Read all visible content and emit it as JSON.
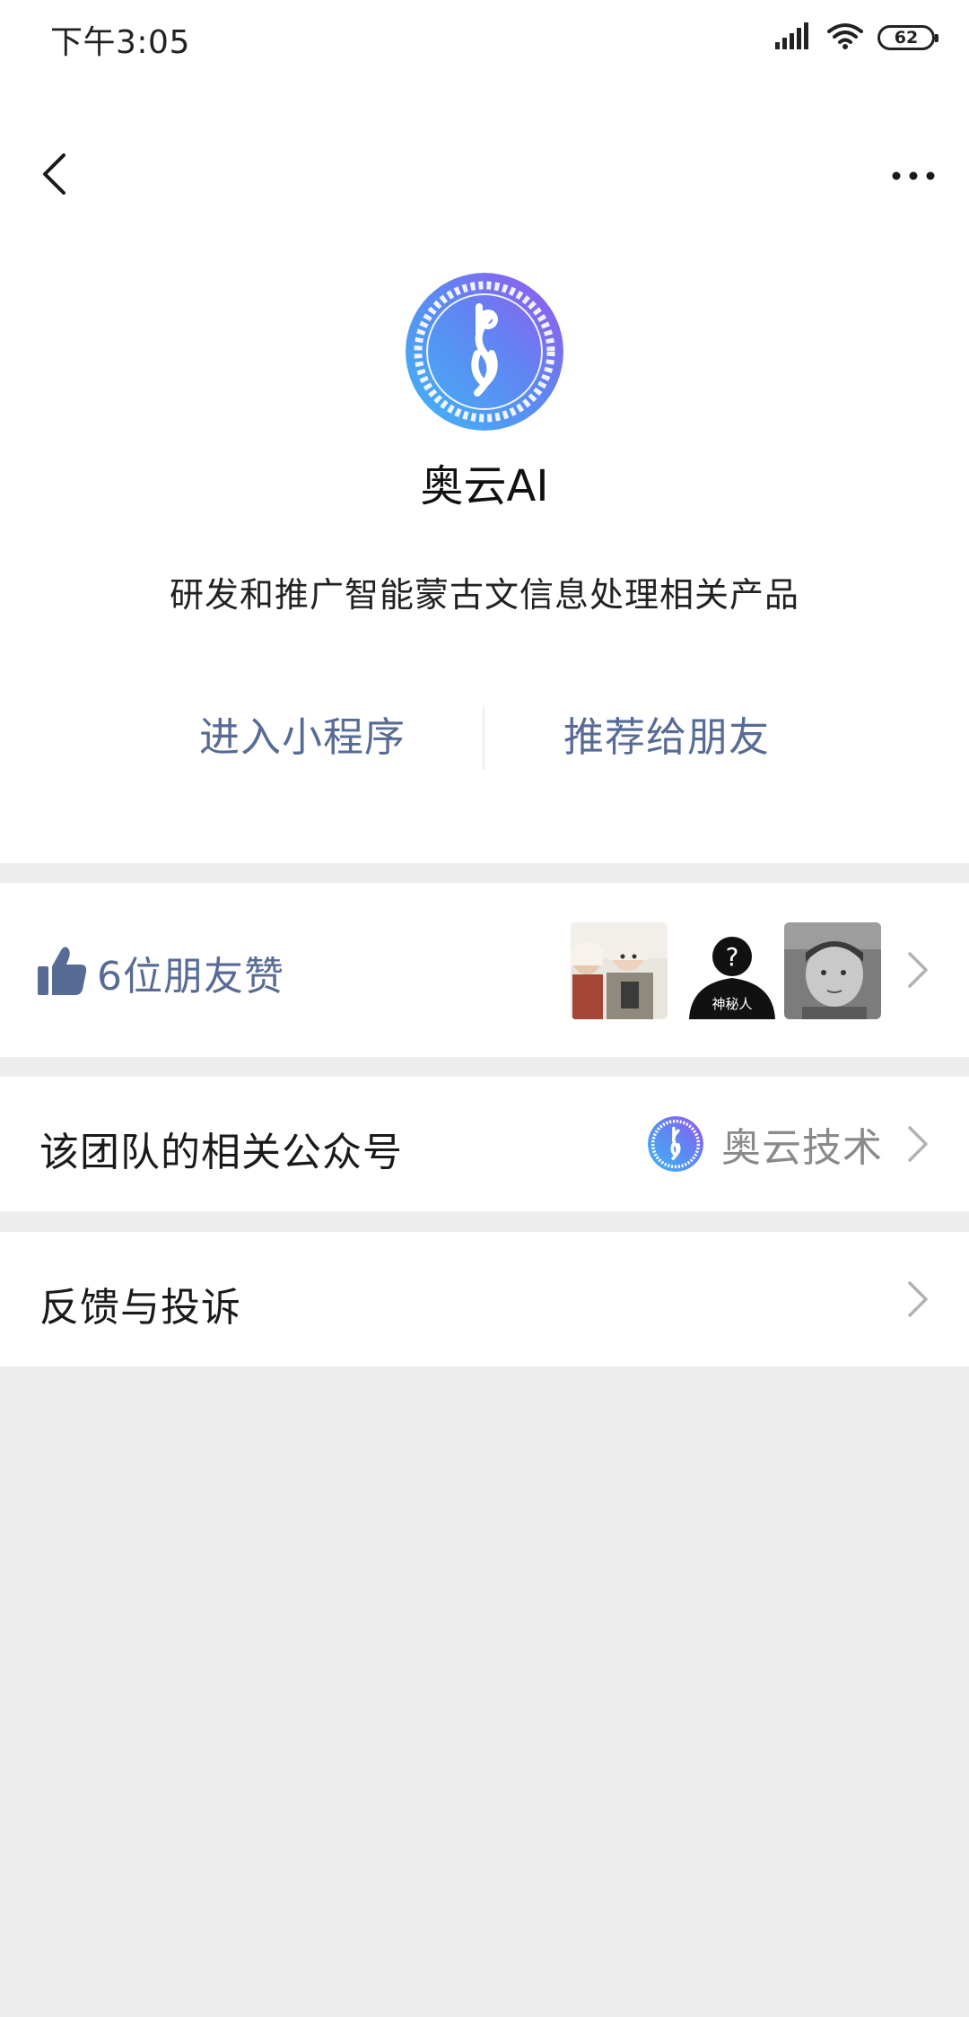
{
  "status_bar": {
    "time": "下午3:05",
    "battery": "62"
  },
  "nav": {
    "back_icon": "chevron-left-icon",
    "more_icon": "more-dots-icon"
  },
  "app": {
    "name": "奥云AI",
    "description": "研发和推广智能蒙古文信息处理相关产品",
    "logo_icon": "aoyun-logo",
    "brand_gradient": [
      "#4ea9f5",
      "#8a5cf0"
    ]
  },
  "actions": {
    "enter_label": "进入小程序",
    "share_label": "推荐给朋友",
    "link_color": "#576b95"
  },
  "likes": {
    "icon": "thumbs-up-icon",
    "text": "6位朋友赞",
    "avatars": [
      {
        "name": "friend-avatar-1",
        "caption": ""
      },
      {
        "name": "friend-avatar-mystery",
        "caption": "神秘人"
      },
      {
        "name": "friend-avatar-3",
        "caption": ""
      }
    ]
  },
  "related": {
    "label": "该团队的相关公众号",
    "account_name": "奥云技术"
  },
  "feedback": {
    "label": "反馈与投诉"
  }
}
